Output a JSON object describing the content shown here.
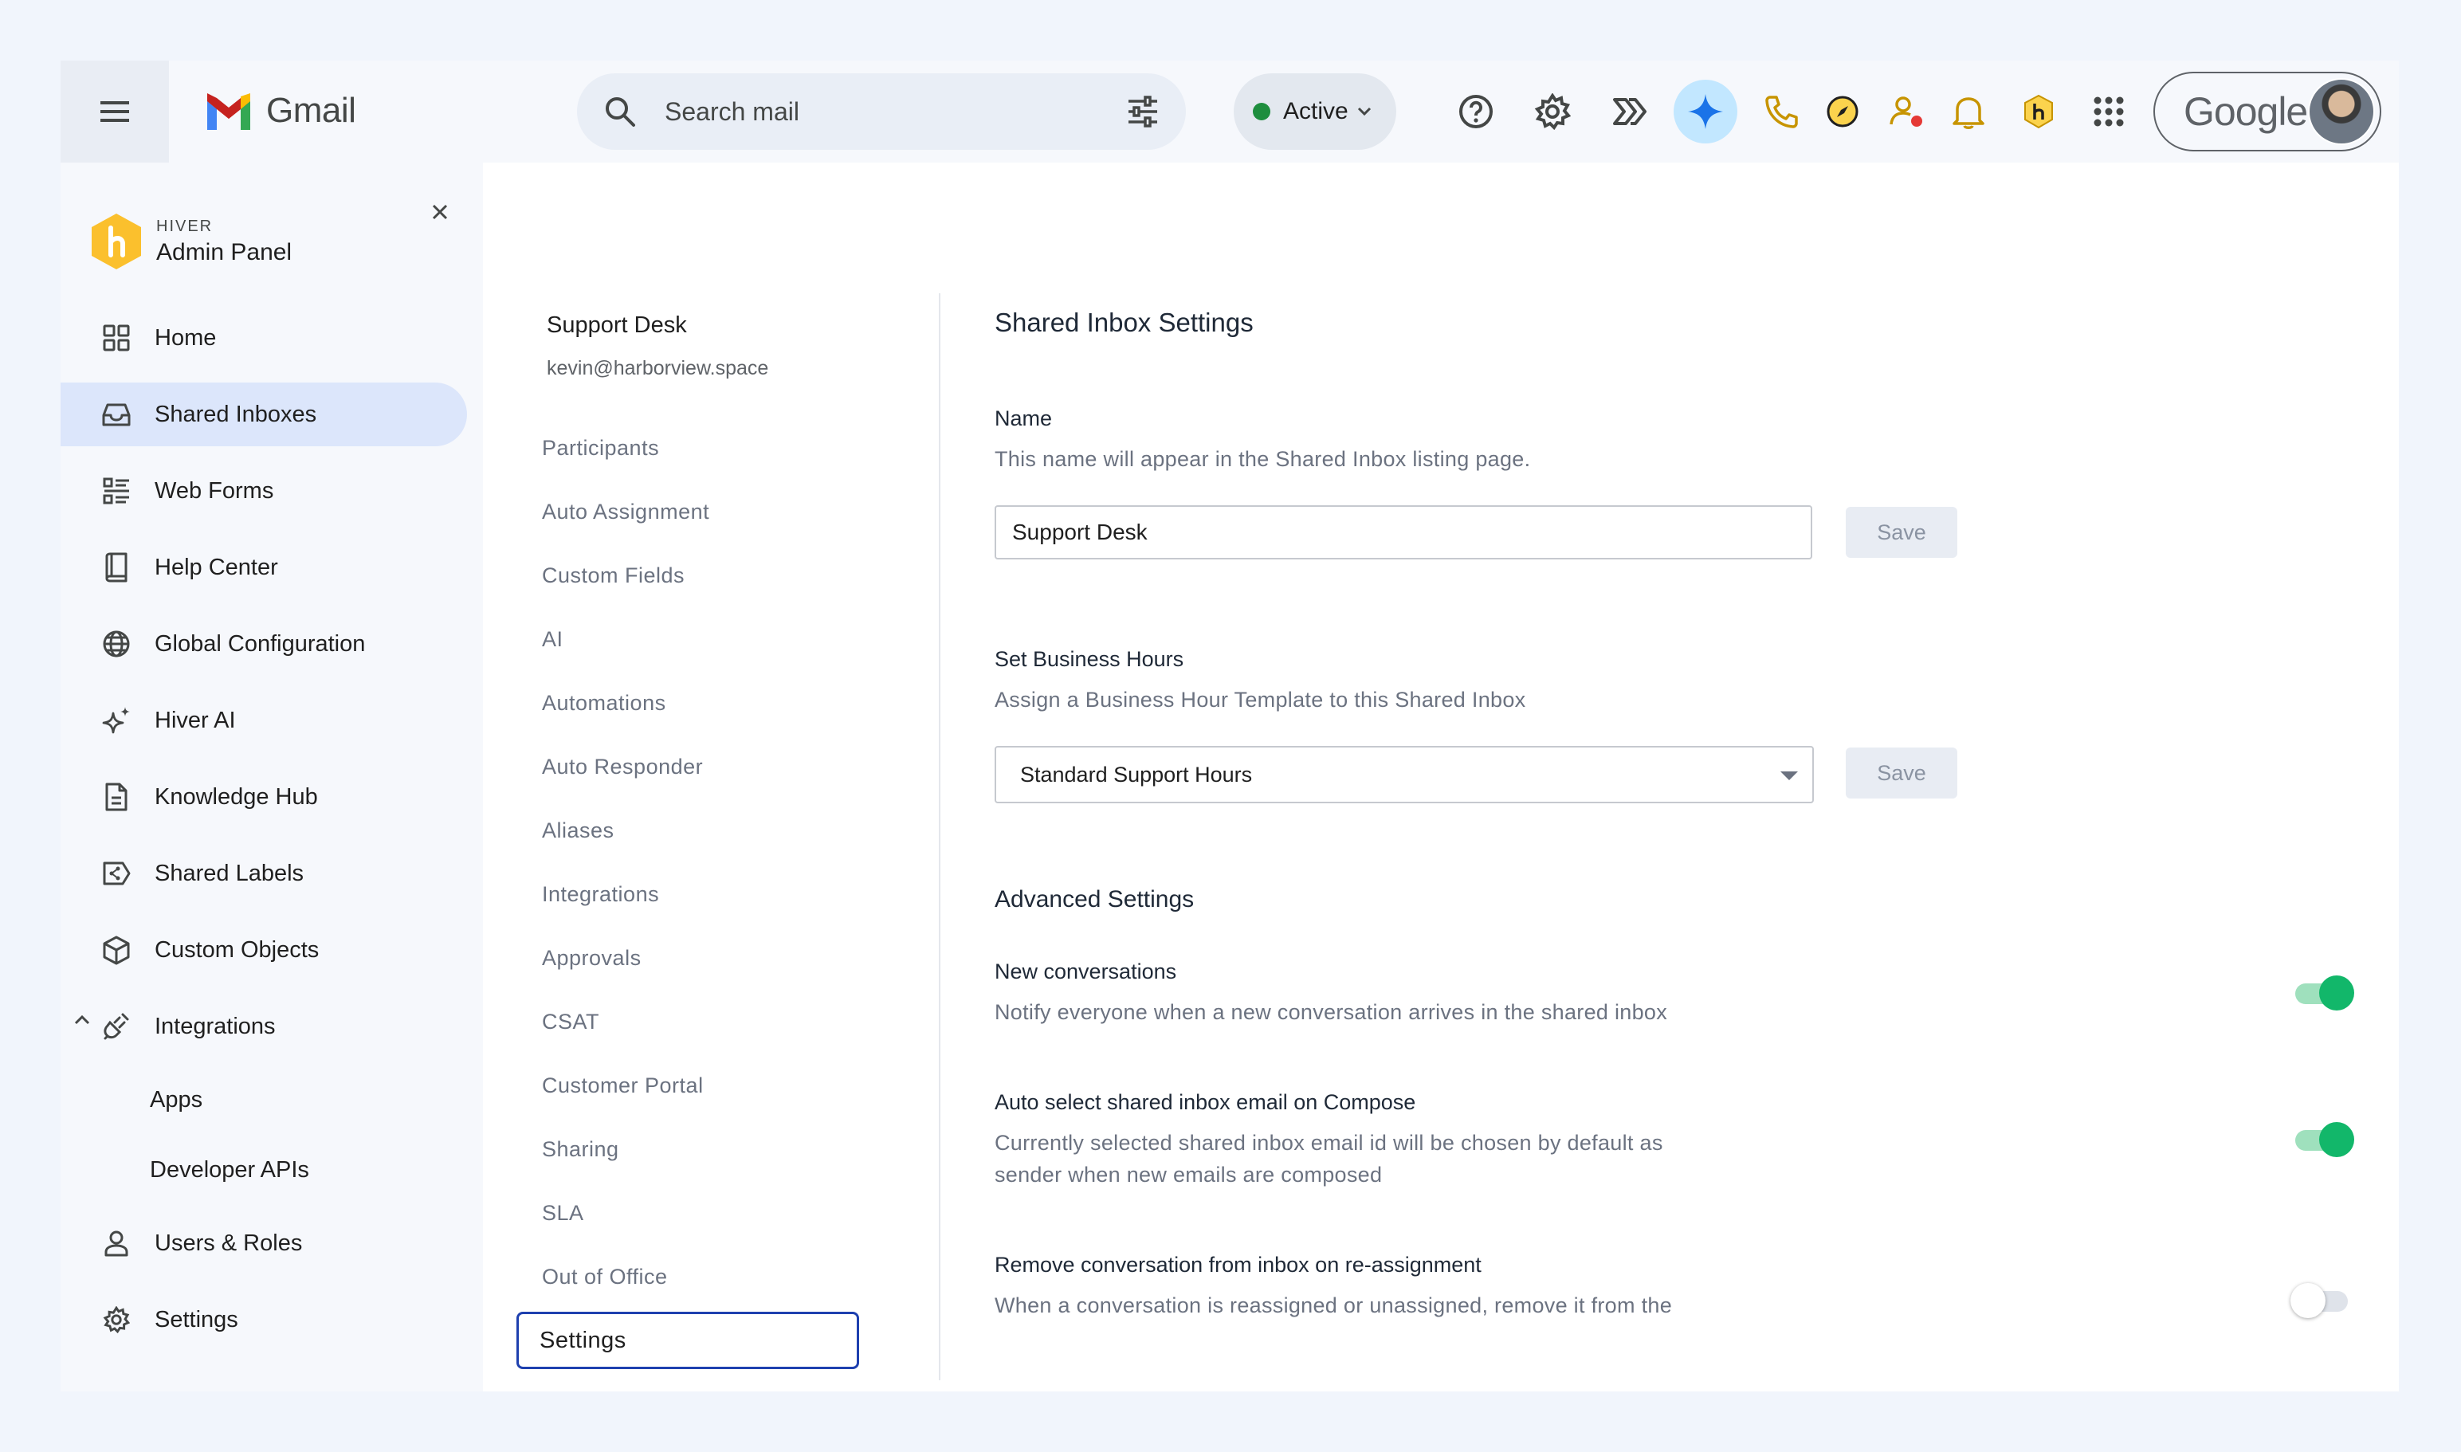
{
  "topbar": {
    "app_name": "Gmail",
    "search_placeholder": "Search mail",
    "status_label": "Active",
    "status_color": "#1e8e3e",
    "account_label": "Google",
    "icons": [
      "help-icon",
      "settings-icon",
      "hiver-icon",
      "gemini-icon",
      "phone-icon",
      "compass-icon",
      "user-status-icon",
      "bell-icon",
      "hiver-badge-icon",
      "apps-grid-icon"
    ]
  },
  "sidebar": {
    "brand_small": "HIVER",
    "brand_title": "Admin Panel",
    "items": [
      {
        "label": "Home",
        "icon": "grid-icon"
      },
      {
        "label": "Shared Inboxes",
        "icon": "inbox-icon"
      },
      {
        "label": "Web Forms",
        "icon": "form-list-icon"
      },
      {
        "label": "Help Center",
        "icon": "book-icon"
      },
      {
        "label": "Global Configuration",
        "icon": "globe-icon"
      },
      {
        "label": "Hiver AI",
        "icon": "sparkle-icon"
      },
      {
        "label": "Knowledge Hub",
        "icon": "document-icon"
      },
      {
        "label": "Shared Labels",
        "icon": "shared-label-icon"
      },
      {
        "label": "Custom Objects",
        "icon": "cube-icon"
      },
      {
        "label": "Integrations",
        "icon": "plug-icon"
      },
      {
        "label": "Users & Roles",
        "icon": "user-icon"
      },
      {
        "label": "Settings",
        "icon": "gear-icon"
      }
    ],
    "integrations_sub": [
      "Apps",
      "Developer APIs"
    ],
    "active_index": 1
  },
  "submenu": {
    "title": "Support Desk",
    "email": "kevin@harborview.space",
    "items": [
      "Participants",
      "Auto Assignment",
      "Custom Fields",
      "AI",
      "Automations",
      "Auto Responder",
      "Aliases",
      "Integrations",
      "Approvals",
      "CSAT",
      "Customer Portal",
      "Sharing",
      "SLA",
      "Out of Office",
      "Settings"
    ],
    "active": "Settings"
  },
  "main": {
    "title": "Shared Inbox Settings",
    "name_label": "Name",
    "name_desc": "This name will appear in the Shared Inbox listing page.",
    "name_value": "Support Desk",
    "save_label": "Save",
    "hours_label": "Set Business Hours",
    "hours_desc": "Assign a Business Hour Template to this Shared Inbox",
    "hours_value": "Standard Support Hours",
    "advanced_title": "Advanced Settings",
    "settings": [
      {
        "label": "New conversations",
        "desc": "Notify everyone when a new conversation arrives in the shared inbox",
        "enabled": true
      },
      {
        "label": "Auto select shared inbox email on Compose",
        "desc": "Currently selected shared inbox email id will be chosen by default as sender when new emails are composed",
        "enabled": true
      },
      {
        "label": "Remove conversation from inbox on re-assignment",
        "desc": "When a conversation is reassigned or unassigned, remove it from the",
        "enabled": false
      }
    ],
    "toggle_on_color": "#12b76a"
  }
}
